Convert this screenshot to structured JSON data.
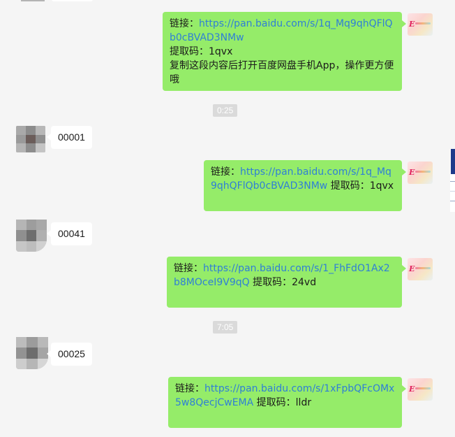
{
  "messages": [
    {
      "type": "out",
      "prefix": "链接：",
      "link": "https://pan.baidu.com/s/1q_Mq9qhQFlQb0cBVAD3NMw",
      "code_line": "提取码：1qvx",
      "note": "复制这段内容后打开百度网盘手机App，操作更方便哦"
    },
    {
      "type": "time",
      "text": "0:25"
    },
    {
      "type": "in",
      "text": "00001"
    },
    {
      "type": "out",
      "prefix": "链接：",
      "link": "https://pan.baidu.com/s/1q_Mq9qhQFlQb0cBVAD3NMw",
      "code": " 提取码：1qvx"
    },
    {
      "type": "in",
      "text": "00041"
    },
    {
      "type": "out",
      "prefix": "链接：",
      "link": "https://pan.baidu.com/s/1_FhFdO1Ax2b8MOceI9V9qQ",
      "code": " 提取码：24vd"
    },
    {
      "type": "time",
      "text": "7:05"
    },
    {
      "type": "in",
      "text": "00025"
    },
    {
      "type": "out",
      "prefix": "链接：",
      "link": "https://pan.baidu.com/s/1xFpbQFcOMx5w8QecjCwEMA",
      "code": " 提取码：lldr"
    }
  ],
  "colors": {
    "outgoing_bubble": "#95ec69",
    "incoming_bubble": "#ffffff",
    "link": "#2f7fd6",
    "chat_background": "#f5f5f5",
    "timestamp_bg": "#dadada"
  },
  "icons": {
    "self_avatar": "pink-logo-avatar",
    "contact_avatar": "pixelated-avatar"
  }
}
